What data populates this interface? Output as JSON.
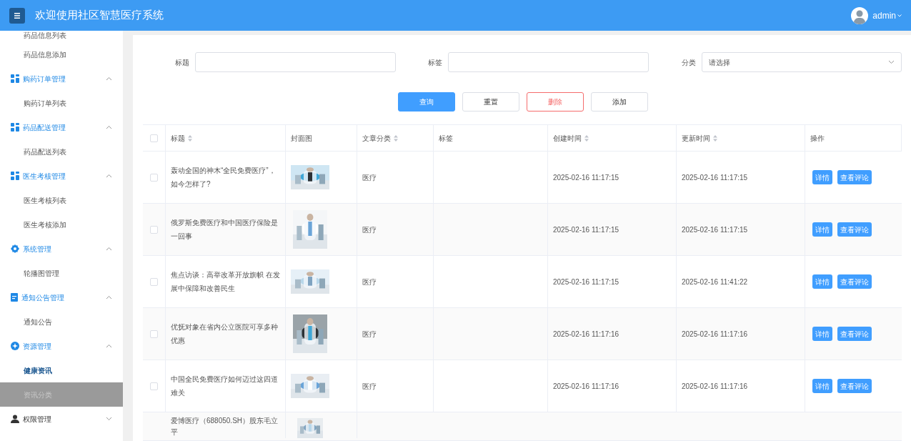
{
  "header": {
    "title": "欢迎使用社区智慧医疗系统",
    "user": "admin"
  },
  "sidebar": {
    "items": [
      {
        "kind": "child",
        "label": "药品信息列表",
        "selected": false,
        "hovered": false
      },
      {
        "kind": "child",
        "label": "药品信息添加",
        "selected": false,
        "hovered": false
      },
      {
        "kind": "group",
        "label": "购药订单管理",
        "expanded": true
      },
      {
        "kind": "child",
        "label": "购药订单列表",
        "selected": false,
        "hovered": false
      },
      {
        "kind": "group",
        "label": "药品配送管理",
        "expanded": true
      },
      {
        "kind": "child",
        "label": "药品配送列表",
        "selected": false,
        "hovered": false
      },
      {
        "kind": "group",
        "label": "医生考核管理",
        "expanded": true
      },
      {
        "kind": "child",
        "label": "医生考核列表",
        "selected": false,
        "hovered": false
      },
      {
        "kind": "child",
        "label": "医生考核添加",
        "selected": false,
        "hovered": false
      },
      {
        "kind": "group",
        "label": "系统管理",
        "expanded": true
      },
      {
        "kind": "child",
        "label": "轮播图管理",
        "selected": false,
        "hovered": false
      },
      {
        "kind": "group",
        "label": "通知公告管理",
        "expanded": true
      },
      {
        "kind": "child",
        "label": "通知公告",
        "selected": false,
        "hovered": false
      },
      {
        "kind": "group",
        "label": "资源管理",
        "expanded": true
      },
      {
        "kind": "child",
        "label": "健康资讯",
        "selected": true,
        "hovered": false
      },
      {
        "kind": "child",
        "label": "资讯分类",
        "selected": false,
        "hovered": true
      },
      {
        "kind": "group",
        "label": "权限管理",
        "expanded": false
      }
    ]
  },
  "search": {
    "fields": [
      {
        "kind": "input",
        "label": "标题"
      },
      {
        "kind": "input",
        "label": "标签"
      },
      {
        "kind": "select",
        "label": "分类",
        "placeholder": "请选择"
      }
    ],
    "buttons": [
      {
        "kind": "primary",
        "label": "查询"
      },
      {
        "kind": "default",
        "label": "重置"
      },
      {
        "kind": "danger",
        "label": "删除"
      },
      {
        "kind": "default",
        "label": "添加"
      }
    ]
  },
  "table": {
    "all_checked": false,
    "columns": [
      {
        "label": "标题",
        "sortable": true
      },
      {
        "label": "封面图",
        "sortable": false
      },
      {
        "label": "文章分类",
        "sortable": true
      },
      {
        "label": "标签",
        "sortable": false
      },
      {
        "label": "创建时间",
        "sortable": true
      },
      {
        "label": "更新时间",
        "sortable": true
      },
      {
        "label": "操作",
        "sortable": false
      }
    ],
    "rows": [
      {
        "checked": false,
        "title": "轰动全国的神木“全民免费医疗”，如今怎样了?",
        "cover": {
          "kind": "picture"
        },
        "category": "医疗",
        "created": "2025-02-16 11:17:15",
        "updated": "2025-02-16 11:17:15",
        "actions": [
          "详情",
          "查看评论"
        ]
      },
      {
        "checked": false,
        "title": "俄罗斯免费医疗和中国医疗保险是一回事",
        "cover": {
          "kind": "picture"
        },
        "category": "医疗",
        "created": "2025-02-16 11:17:15",
        "updated": "2025-02-16 11:17:15",
        "actions": [
          "详情",
          "查看评论"
        ]
      },
      {
        "checked": false,
        "title": "焦点访谈：高举改革开放旗帜 在发展中保障和改善民生",
        "cover": {
          "kind": "picture"
        },
        "category": "医疗",
        "created": "2025-02-16 11:17:15",
        "updated": "2025-02-16 11:41:22",
        "actions": [
          "详情",
          "查看评论"
        ]
      },
      {
        "checked": false,
        "title": "优抚对象在省内公立医院可享多种优惠",
        "cover": {
          "kind": "picture"
        },
        "category": "医疗",
        "created": "2025-02-16 11:17:16",
        "updated": "2025-02-16 11:17:16",
        "actions": [
          "详情",
          "查看评论"
        ]
      },
      {
        "checked": false,
        "title": "中国全民免费医疗如何迈过这四道难关",
        "cover": {
          "kind": "picture"
        },
        "category": "医疗",
        "created": "2025-02-16 11:17:16",
        "updated": "2025-02-16 11:17:16",
        "actions": [
          "详情",
          "查看评论"
        ]
      },
      {
        "title": "爱博医疗（688050.SH）股东毛立平",
        "cover": {
          "kind": "picture"
        }
      }
    ]
  }
}
